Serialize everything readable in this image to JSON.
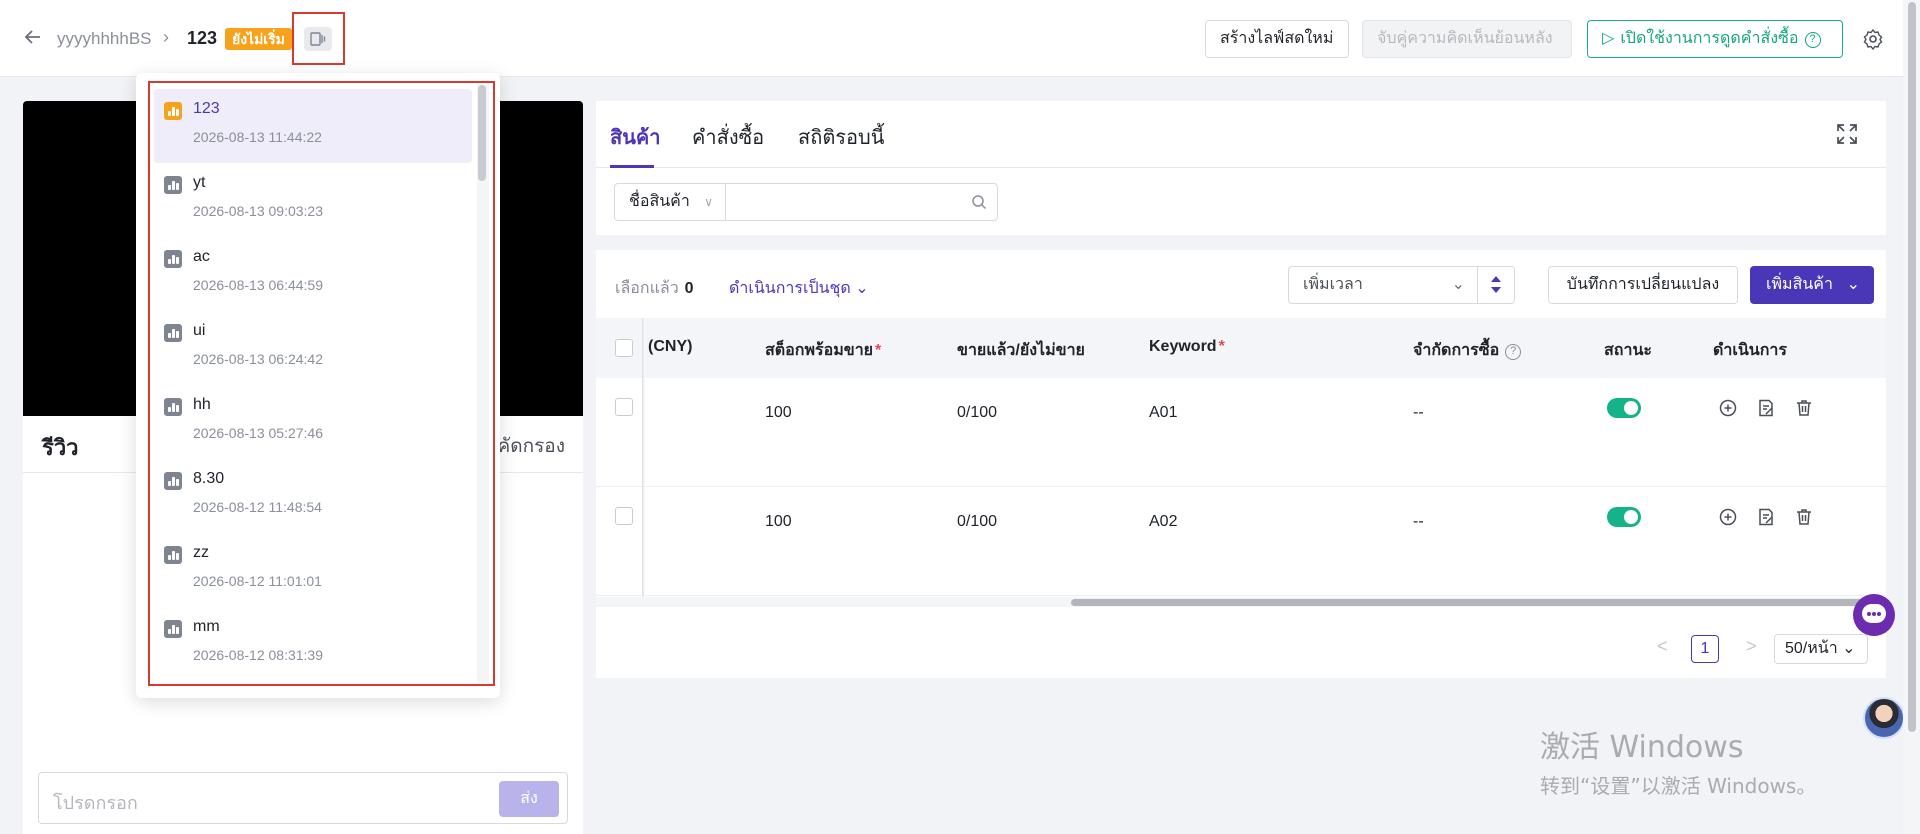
{
  "header": {
    "store_name": "yyyyhhhhBS",
    "live_name": "123",
    "status_badge": "ยังไม่เริ่ม",
    "new_live_button": "สร้างไลฟ์สดใหม่",
    "match_feedback_button": "จับคู่ความคิดเห็นย้อนหลัง",
    "enable_order_capture_button": "เปิดใช้งานการดูดคำสั่งซื้อ",
    "icons": [
      "back-arrow-icon",
      "chevron-right-icon",
      "live-switch-icon",
      "play-icon",
      "help-icon",
      "settings-icon"
    ]
  },
  "live_list": [
    {
      "name": "123",
      "time": "2026-08-13 11:44:22",
      "active": true
    },
    {
      "name": "yt",
      "time": "2026-08-13 09:03:23"
    },
    {
      "name": "ac",
      "time": "2026-08-13 06:44:59"
    },
    {
      "name": "ui",
      "time": "2026-08-13 06:24:42"
    },
    {
      "name": "hh",
      "time": "2026-08-13 05:27:46"
    },
    {
      "name": "8.30",
      "time": "2026-08-12 11:48:54"
    },
    {
      "name": "zz",
      "time": "2026-08-12 11:01:01"
    },
    {
      "name": "mm",
      "time": "2026-08-12 08:31:39"
    }
  ],
  "review": {
    "title": "รีวิว",
    "filter_label": "คัดกรอง",
    "input_placeholder": "โปรดกรอก",
    "send_button": "ส่ง"
  },
  "tabs": [
    "สินค้า",
    "คำสั่งซื้อ",
    "สถิติรอบนี้"
  ],
  "filter": {
    "field_select": "ชื่อสินค้า",
    "search_value": ""
  },
  "toolbar": {
    "selected_label": "เลือกแล้ว",
    "selected_count": "0",
    "bulk_action": "ดำเนินการเป็นชุด",
    "time_sort": "เพิ่มเวลา",
    "save_changes": "บันทึกการเปลี่ยนแปลง",
    "add_product": "เพิ่มสินค้า"
  },
  "table": {
    "columns": [
      "(CNY)",
      "สต็อกพร้อมขาย",
      "ขายแล้ว/ยังไม่ขาย",
      "Keyword",
      "จำกัดการซื้อ",
      "สถานะ",
      "ดำเนินการ"
    ],
    "rows": [
      {
        "stock": "100",
        "sold": "0/100",
        "keyword": "A01",
        "limit": "--",
        "status_on": true
      },
      {
        "stock": "100",
        "sold": "0/100",
        "keyword": "A02",
        "limit": "--",
        "status_on": true
      }
    ]
  },
  "pagination": {
    "prev": "<",
    "page": "1",
    "next": ">",
    "page_size": "50/หน้า"
  },
  "watermark": {
    "line1": "激活 Windows",
    "line2": "转到“设置”以激活 Windows。"
  },
  "colors": {
    "brand": "#4a37b8",
    "status_badge": "#f7a21b",
    "toggle_on": "#14b389",
    "enable_button": "#14a67f",
    "highlight_frame": "#d93a2f"
  }
}
